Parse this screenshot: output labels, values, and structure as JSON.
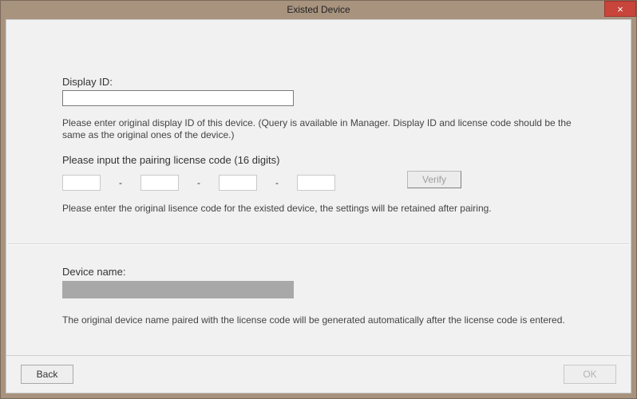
{
  "window": {
    "title": "Existed Device",
    "close_glyph": "×"
  },
  "section_display": {
    "label": "Display ID:",
    "value": "",
    "help": "Please enter original display ID of this device. (Query is available in Manager. Display ID and license code should be the same as the original ones of the device.)"
  },
  "section_code": {
    "label": "Please input the pairing license code (16 digits)",
    "segments": [
      "",
      "",
      "",
      ""
    ],
    "separator": "-",
    "verify_label": "Verify",
    "help": "Please enter the original lisence code for the existed device, the settings will be retained after pairing."
  },
  "section_device": {
    "label": "Device name:",
    "value": "",
    "help": "The original device name paired with the license code will be generated automatically after the license code is entered."
  },
  "footer": {
    "back_label": "Back",
    "ok_label": "OK"
  }
}
